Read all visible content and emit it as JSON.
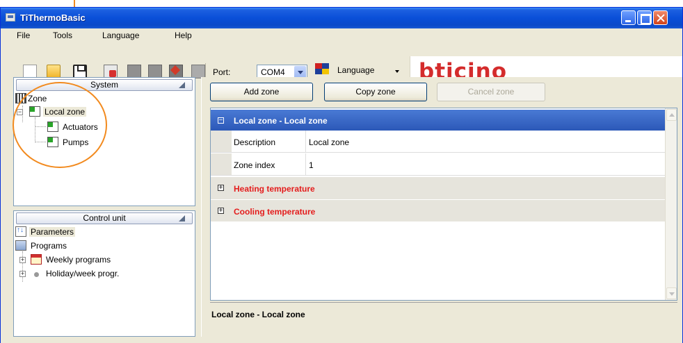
{
  "window": {
    "title": "TiThermoBasic"
  },
  "menu": {
    "items": [
      "File",
      "Tools",
      "Language",
      "Help"
    ]
  },
  "toolbar": {
    "port_label": "Port:",
    "port_value": "COM4",
    "language_label": "Language",
    "brand": "bticino",
    "icons": [
      "new-icon",
      "open-folder-icon",
      "save-icon",
      "delete-icon",
      "disabled-icon",
      "disabled-icon",
      "send-icon",
      "document-icon"
    ]
  },
  "system_panel": {
    "header": "System",
    "tree": {
      "root": "Zone",
      "child": "Local zone",
      "leaves": [
        "Actuators",
        "Pumps"
      ]
    }
  },
  "control_panel": {
    "header": "Control unit",
    "items": [
      "Parameters",
      "Programs",
      "Weekly programs",
      "Holiday/week progr."
    ]
  },
  "buttons": {
    "add": "Add zone",
    "copy": "Copy zone",
    "cancel": "Cancel zone"
  },
  "grid": {
    "header": "Local zone - Local zone",
    "properties": [
      {
        "name": "Description",
        "value": "Local zone"
      },
      {
        "name": "Zone index",
        "value": "1"
      }
    ],
    "categories": [
      "Heating temperature",
      "Cooling temperature"
    ]
  },
  "description": {
    "title": "Local zone - Local zone"
  },
  "colors": {
    "category_text": "#e41c1c",
    "header_row": "#2c58b8",
    "annotation": "#f28a1e",
    "brand": "#d42c2c"
  }
}
